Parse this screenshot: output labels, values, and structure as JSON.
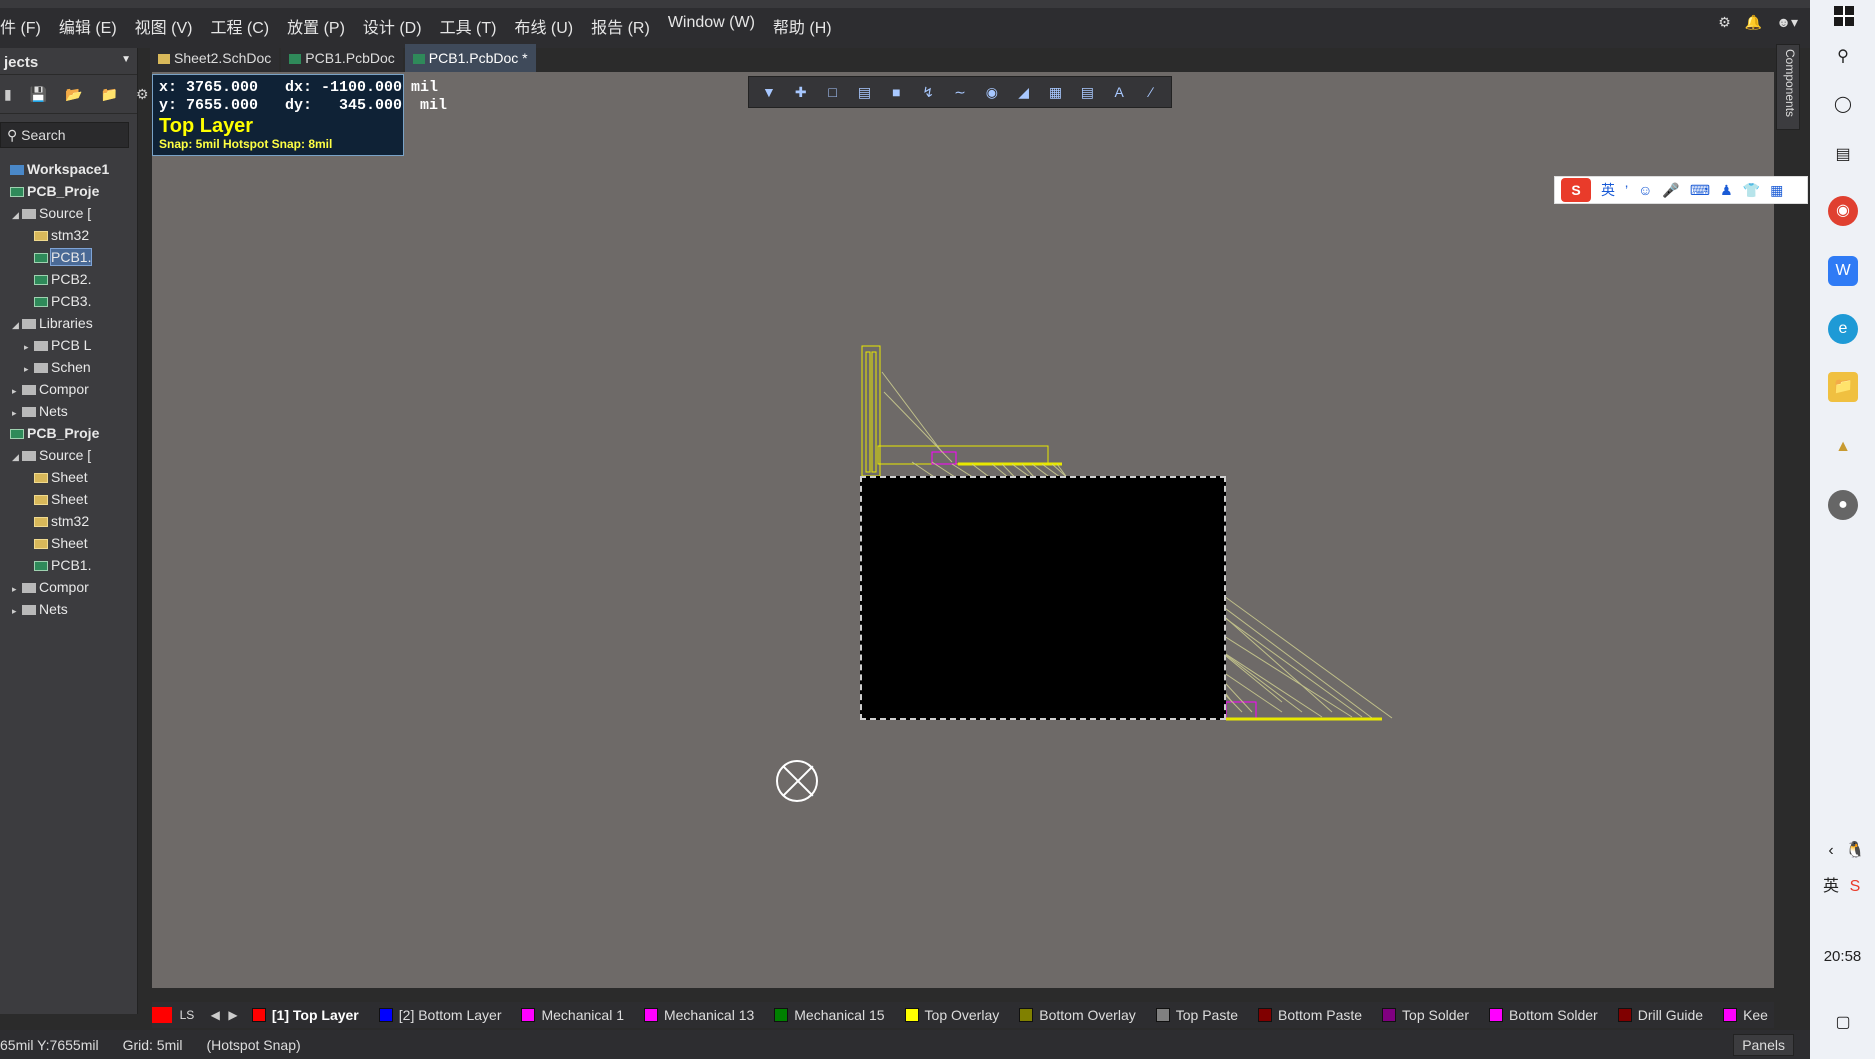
{
  "menu": {
    "items": [
      "件 (F)",
      "编辑 (E)",
      "视图 (V)",
      "工程 (C)",
      "放置 (P)",
      "设计 (D)",
      "工具 (T)",
      "布线 (U)",
      "报告 (R)",
      "Window (W)",
      "帮助 (H)"
    ]
  },
  "left_panel": {
    "title": "jects",
    "search_placeholder": "Search",
    "tree": [
      {
        "label": "Workspace1",
        "icon": "workspace-icon",
        "bold": true,
        "indent": 0
      },
      {
        "label": "PCB_Proje",
        "icon": "pcb-project-icon",
        "bold": true,
        "indent": 0
      },
      {
        "label": "Source [",
        "icon": "folder-icon",
        "indent": 1,
        "arrow": "◢"
      },
      {
        "label": "stm32",
        "icon": "schematic-icon",
        "indent": 2
      },
      {
        "label": "PCB1.",
        "icon": "pcb-icon",
        "indent": 2,
        "selected": true
      },
      {
        "label": "PCB2.",
        "icon": "pcb-icon",
        "indent": 2
      },
      {
        "label": "PCB3.",
        "icon": "pcb-icon",
        "indent": 2
      },
      {
        "label": "Libraries",
        "icon": "folder-icon",
        "indent": 1,
        "arrow": "◢"
      },
      {
        "label": "PCB L",
        "icon": "folder-icon",
        "indent": 2,
        "arrow": "▸"
      },
      {
        "label": "Schen",
        "icon": "folder-icon",
        "indent": 2,
        "arrow": "▸"
      },
      {
        "label": "Compor",
        "icon": "folder-icon",
        "indent": 1,
        "arrow": "▸"
      },
      {
        "label": "Nets",
        "icon": "folder-icon",
        "indent": 1,
        "arrow": "▸"
      },
      {
        "label": "PCB_Proje",
        "icon": "pcb-project-icon",
        "bold": true,
        "indent": 0
      },
      {
        "label": "Source [",
        "icon": "folder-icon",
        "indent": 1,
        "arrow": "◢"
      },
      {
        "label": "Sheet",
        "icon": "schematic-icon",
        "indent": 2
      },
      {
        "label": "Sheet",
        "icon": "schematic-icon",
        "indent": 2
      },
      {
        "label": "stm32",
        "icon": "schematic-icon",
        "indent": 2
      },
      {
        "label": "Sheet",
        "icon": "schematic-icon",
        "indent": 2
      },
      {
        "label": "PCB1.",
        "icon": "pcb-icon",
        "indent": 2
      },
      {
        "label": "Compor",
        "icon": "folder-icon",
        "indent": 1,
        "arrow": "▸"
      },
      {
        "label": "Nets",
        "icon": "folder-icon",
        "indent": 1,
        "arrow": "▸"
      }
    ]
  },
  "tabs": [
    {
      "label": "Sheet2.SchDoc",
      "icon": "schematic-icon"
    },
    {
      "label": "PCB1.PcbDoc",
      "icon": "pcb-icon"
    },
    {
      "label": "PCB1.PcbDoc *",
      "icon": "pcb-icon",
      "active": true
    }
  ],
  "readout": {
    "line1": "x: 3765.000   dx: -1100.000 mil",
    "line2": "y: 7655.000   dy:   345.000  mil",
    "layer": "Top Layer",
    "snap": "Snap: 5mil Hotspot Snap: 8mil"
  },
  "components_tab": "Components",
  "layer_bar": {
    "ls_label": "LS",
    "current_color": "#ff0000",
    "layers": [
      {
        "label": "[1] Top Layer",
        "color": "#ff0000",
        "active": true
      },
      {
        "label": "[2] Bottom Layer",
        "color": "#0000ff"
      },
      {
        "label": "Mechanical 1",
        "color": "#ff00ff"
      },
      {
        "label": "Mechanical 13",
        "color": "#ff00ff"
      },
      {
        "label": "Mechanical 15",
        "color": "#008000"
      },
      {
        "label": "Top Overlay",
        "color": "#ffff00"
      },
      {
        "label": "Bottom Overlay",
        "color": "#808000"
      },
      {
        "label": "Top Paste",
        "color": "#808080"
      },
      {
        "label": "Bottom Paste",
        "color": "#800000"
      },
      {
        "label": "Top Solder",
        "color": "#800080"
      },
      {
        "label": "Bottom Solder",
        "color": "#ff00ff"
      },
      {
        "label": "Drill Guide",
        "color": "#800000"
      },
      {
        "label": "Kee",
        "color": "#ff00ff"
      }
    ]
  },
  "status": {
    "coords": "65mil Y:7655mil",
    "grid": "Grid: 5mil",
    "snap": "(Hotspot Snap)",
    "panels": "Panels"
  },
  "taskbar": {
    "clock": "20:58"
  },
  "ime": {
    "mode": "英"
  }
}
